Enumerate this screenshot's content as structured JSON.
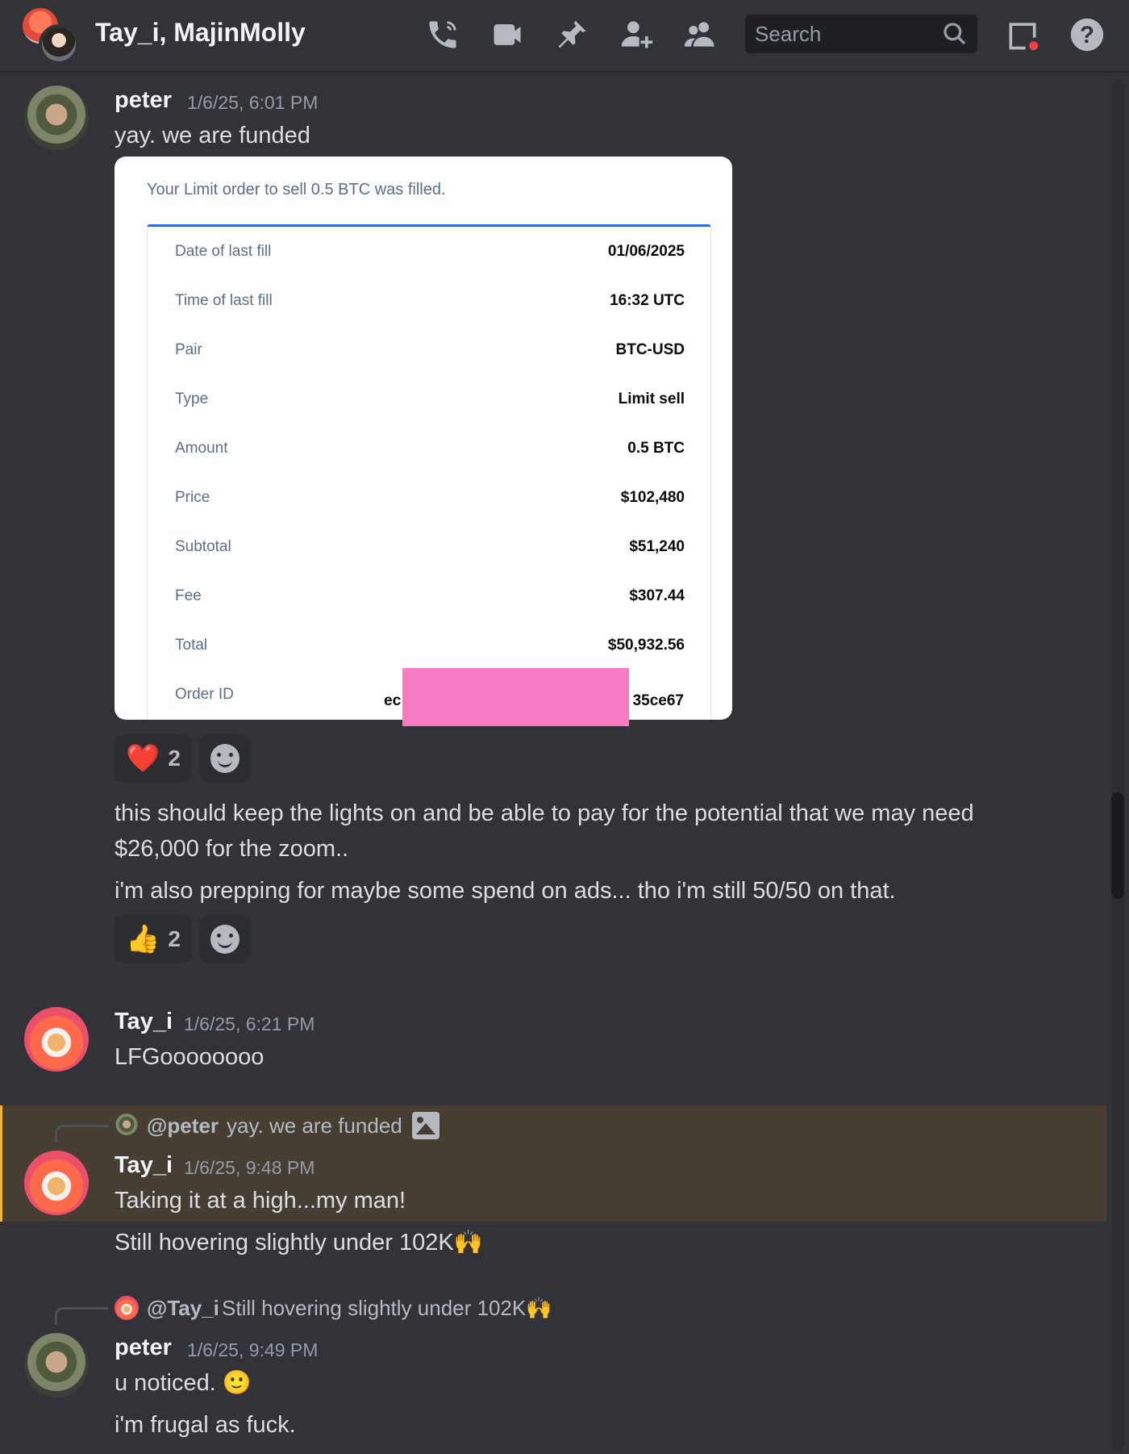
{
  "header": {
    "title": "Tay_i, MajinMolly",
    "search_placeholder": "Search",
    "icons": [
      "phone-call-icon",
      "video-icon",
      "pin-icon",
      "add-friend-icon",
      "members-icon",
      "search-icon",
      "inbox-icon",
      "help-icon"
    ]
  },
  "colors": {
    "background": "#313338",
    "mention_highlight": "#473e33",
    "mention_bar": "#f0b232",
    "redaction": "#f87ac4"
  },
  "messages": [
    {
      "author": "peter",
      "timestamp": "1/6/25, 6:01 PM",
      "text": "yay. we are funded",
      "embed": {
        "header": "Your Limit order to sell 0.5 BTC was filled.",
        "rows": [
          {
            "label": "Date of last fill",
            "value": "01/06/2025"
          },
          {
            "label": "Time of last fill",
            "value": "16:32 UTC"
          },
          {
            "label": "Pair",
            "value": "BTC-USD"
          },
          {
            "label": "Type",
            "value": "Limit sell"
          },
          {
            "label": "Amount",
            "value": "0.5 BTC"
          },
          {
            "label": "Price",
            "value": "$102,480"
          },
          {
            "label": "Subtotal",
            "value": "$51,240"
          },
          {
            "label": "Fee",
            "value": "$307.44"
          },
          {
            "label": "Total",
            "value": "$50,932.56"
          }
        ],
        "order_id": {
          "label": "Order ID",
          "value_start": "ec",
          "value_end": "35ce67"
        }
      },
      "reactions": [
        {
          "emoji": "❤️",
          "count": "2"
        }
      ]
    },
    {
      "author": "peter",
      "continuation": true,
      "text": "this should keep the lights on and be able to pay for the potential that we may need $26,000 for the zoom.."
    },
    {
      "author": "peter",
      "continuation": true,
      "text": "i'm also prepping for maybe some spend on ads... tho i'm still 50/50 on that.",
      "reactions": [
        {
          "emoji": "👍",
          "count": "2"
        }
      ]
    },
    {
      "author": "Tay_i",
      "timestamp": "1/6/25, 6:21 PM",
      "text": "LFGoooooooo"
    },
    {
      "author": "Tay_i",
      "timestamp": "1/6/25, 9:48 PM",
      "reply_to": {
        "name": "@peter",
        "text": "yay. we are funded"
      },
      "text": "Taking it at a high...my man!"
    },
    {
      "author": "Tay_i",
      "continuation": true,
      "text": "Still hovering slightly under 102K🙌"
    },
    {
      "author": "peter",
      "timestamp": "1/6/25, 9:49 PM",
      "reply_to": {
        "name": "@Tay_i",
        "text": "Still hovering slightly under 102K🙌"
      },
      "text": "u noticed. 🙂"
    },
    {
      "author": "peter",
      "continuation": true,
      "text": "i'm frugal as fuck."
    }
  ]
}
